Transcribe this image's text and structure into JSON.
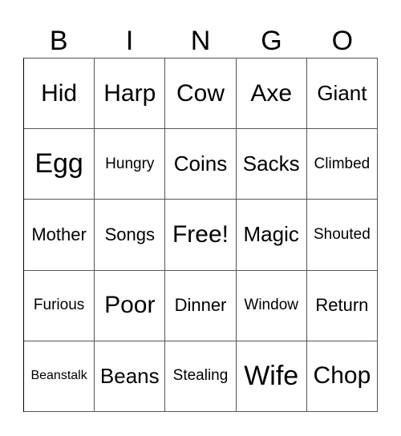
{
  "header": [
    "B",
    "I",
    "N",
    "G",
    "O"
  ],
  "rows": [
    [
      "Hid",
      "Harp",
      "Cow",
      "Axe",
      "Giant"
    ],
    [
      "Egg",
      "Hungry",
      "Coins",
      "Sacks",
      "Climbed"
    ],
    [
      "Mother",
      "Songs",
      "Free!",
      "Magic",
      "Shouted"
    ],
    [
      "Furious",
      "Poor",
      "Dinner",
      "Window",
      "Return"
    ],
    [
      "Beanstalk",
      "Beans",
      "Stealing",
      "Wife",
      "Chop"
    ]
  ]
}
